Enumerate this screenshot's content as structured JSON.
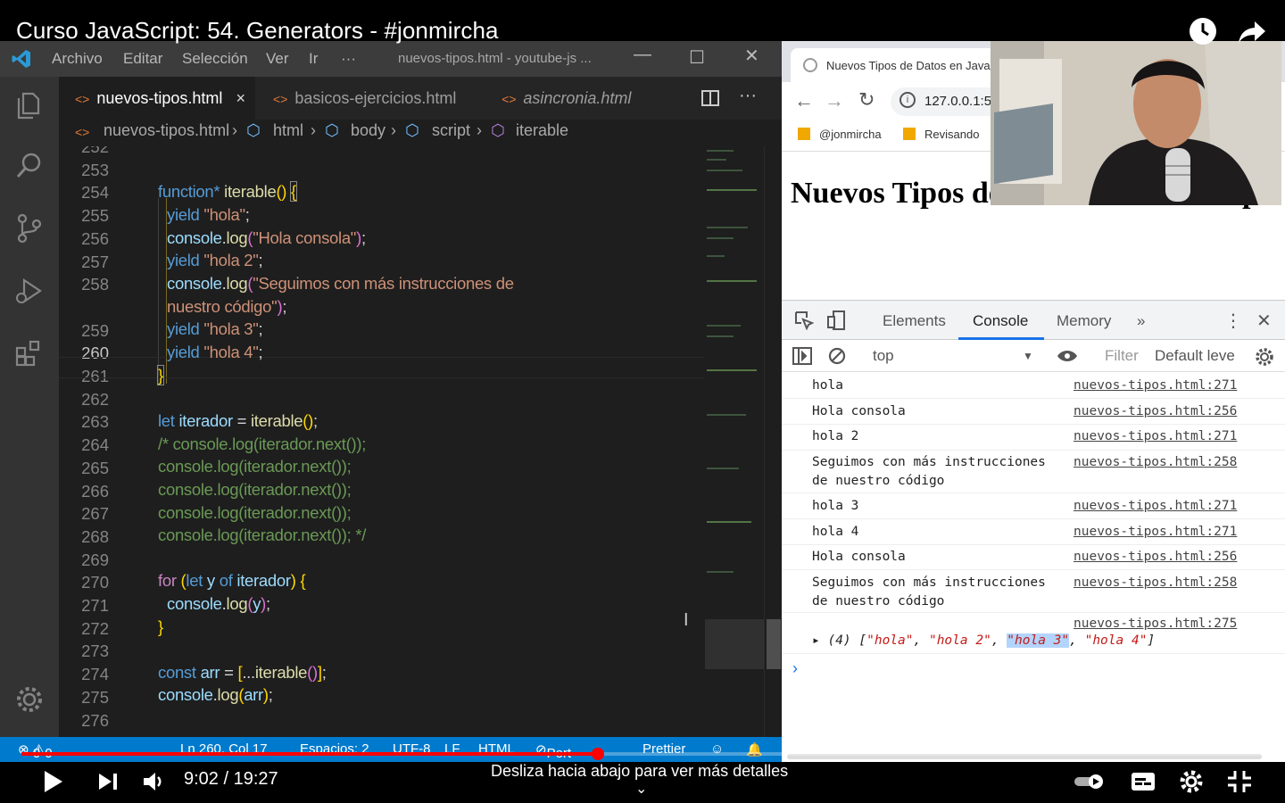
{
  "video": {
    "title": "Curso JavaScript: 54. Generators - #jonmircha",
    "time_current": "9:02",
    "time_separator": " / ",
    "time_total": "19:27",
    "progress_fraction": 0.464,
    "swipe_hint": "Desliza hacia abajo para ver más detalles",
    "accent_color": "#ff0000"
  },
  "vscode": {
    "menu": [
      "Archivo",
      "Editar",
      "Selección",
      "Ver",
      "Ir",
      "···"
    ],
    "window_title": "nuevos-tipos.html - youtube-js ...",
    "tabs": [
      {
        "label": "nuevos-tipos.html",
        "close": "×"
      },
      {
        "label": "basicos-ejercicios.html"
      },
      {
        "label": "asincronia.html"
      }
    ],
    "breadcrumb": [
      "nuevos-tipos.html",
      "html",
      "body",
      "script",
      "iterable"
    ],
    "line_numbers": [
      "252",
      "253",
      "254",
      "255",
      "256",
      "257",
      "258",
      "",
      "259",
      "260",
      "261",
      "262",
      "263",
      "264",
      "265",
      "266",
      "267",
      "268",
      "269",
      "270",
      "271",
      "272",
      "273",
      "274",
      "275",
      "276"
    ],
    "status": {
      "errors": "0",
      "warnings": "0",
      "position": "Ln 260, Col 17",
      "spaces": "Espacios: 2",
      "encoding": "UTF-8",
      "eol": "LF",
      "language": "HTML",
      "port": "Port : 5500",
      "formatter": "Prettier"
    },
    "accent_color": "#007acc"
  },
  "browser": {
    "tab_title": "Nuevos Tipos de Datos en JavaScript",
    "url": "127.0.0.1:5",
    "bookmarks": [
      "@jonmircha",
      "Revisando"
    ],
    "page_heading": "Nuevos Tipos de Datos en JavaScript"
  },
  "devtools": {
    "tabs": [
      "Elements",
      "Console",
      "Memory",
      "»"
    ],
    "context": "top",
    "filter_placeholder": "Filter",
    "levels": "Default leve",
    "logs": [
      {
        "msg": "hola",
        "src": "nuevos-tipos.html:271"
      },
      {
        "msg": "Hola consola",
        "src": "nuevos-tipos.html:256"
      },
      {
        "msg": "hola 2",
        "src": "nuevos-tipos.html:271"
      },
      {
        "msg": "Seguimos con más instrucciones\nde nuestro código",
        "src": "nuevos-tipos.html:258"
      },
      {
        "msg": "hola 3",
        "src": "nuevos-tipos.html:271"
      },
      {
        "msg": "hola 4",
        "src": "nuevos-tipos.html:271"
      },
      {
        "msg": "Hola consola",
        "src": "nuevos-tipos.html:256"
      },
      {
        "msg": "Seguimos con más instrucciones\nde nuestro código",
        "src": "nuevos-tipos.html:258"
      },
      {
        "msg": "",
        "src": "nuevos-tipos.html:275"
      }
    ],
    "array_output": {
      "prefix": "▸ (4) [",
      "items": [
        "\"hola\"",
        "\"hola 2\"",
        "\"hola 3\"",
        "\"hola 4\""
      ],
      "suffix": "]"
    },
    "prompt": "›"
  }
}
